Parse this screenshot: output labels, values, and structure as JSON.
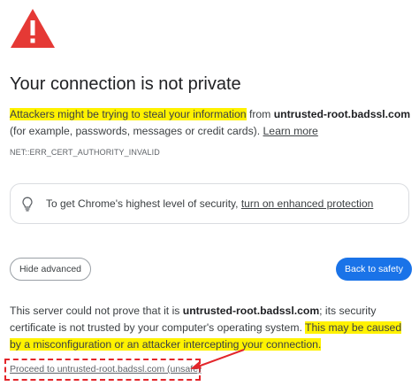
{
  "title": "Your connection is not private",
  "intro": {
    "highlight": "Attackers might be trying to steal your information",
    "from": " from ",
    "domain": "untrusted-root.badssl.com",
    "rest": " (for example, passwords, messages or credit cards). ",
    "learn_more": "Learn more"
  },
  "error_code": "NET::ERR_CERT_AUTHORITY_INVALID",
  "security_tip": {
    "text": "To get Chrome's highest level of security, ",
    "link": "turn on enhanced protection"
  },
  "buttons": {
    "hide_advanced": "Hide advanced",
    "back_to_safety": "Back to safety"
  },
  "details": {
    "part1": "This server could not prove that it is ",
    "domain": "untrusted-root.badssl.com",
    "part2": "; its security certificate is not trusted by your computer's operating system. ",
    "highlight": "This may be caused by a misconfiguration or an attacker intercepting your connection."
  },
  "proceed_link": "Proceed to untrusted-root.badssl.com (unsafe)",
  "colors": {
    "warning_red": "#e53935",
    "highlight_yellow": "#fff200",
    "primary_blue": "#1a73e8",
    "annotation_red": "#e3262b"
  },
  "icons": {
    "warning": "warning-triangle-icon",
    "tip": "lightbulb-icon",
    "annotation": "red-arrow-icon"
  }
}
